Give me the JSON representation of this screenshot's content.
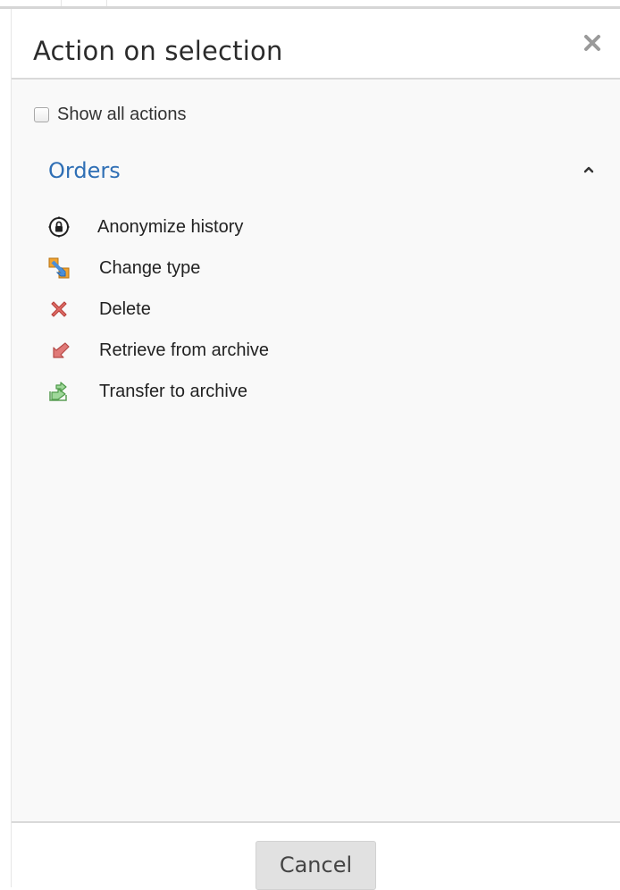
{
  "dialog": {
    "title": "Action on selection",
    "close_icon": "close-icon"
  },
  "options": {
    "show_all_actions": {
      "label": "Show all actions",
      "checked": false
    }
  },
  "group": {
    "title": "Orders",
    "expanded": true,
    "chevron_icon": "chevron-up-icon"
  },
  "actions": [
    {
      "label": "Anonymize history",
      "icon": "anonymize-lock-icon"
    },
    {
      "label": "Change type",
      "icon": "change-type-icon"
    },
    {
      "label": "Delete",
      "icon": "delete-x-icon"
    },
    {
      "label": "Retrieve from archive",
      "icon": "retrieve-arrow-icon"
    },
    {
      "label": "Transfer to archive",
      "icon": "transfer-arrow-icon"
    }
  ],
  "footer": {
    "cancel_label": "Cancel"
  },
  "colors": {
    "group_title": "#2f6fb5",
    "cancel_bg": "#e1e1e1",
    "delete_red": "#d9534f",
    "transfer_green": "#7cc576"
  }
}
